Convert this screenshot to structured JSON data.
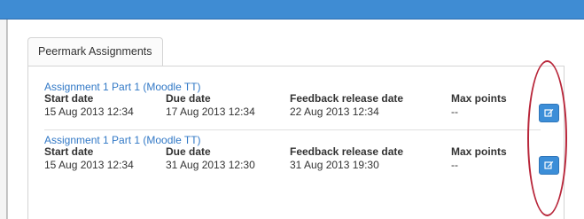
{
  "tab": {
    "label": "Peermark Assignments"
  },
  "headers": {
    "start": "Start date",
    "due": "Due date",
    "feedback": "Feedback release date",
    "max": "Max points"
  },
  "assignments": [
    {
      "title": "Assignment 1 Part 1 (Moodle TT)",
      "start": "15 Aug 2013 12:34",
      "due": "17 Aug 2013 12:34",
      "feedback": "22 Aug 2013 12:34",
      "max": "--"
    },
    {
      "title": "Assignment 1 Part 1 (Moodle TT)",
      "start": "15 Aug 2013 12:34",
      "due": "31 Aug 2013 12:30",
      "feedback": "31 Aug 2013 19:30",
      "max": "--"
    }
  ],
  "icons": {
    "edit": "edit-icon"
  },
  "colors": {
    "accent": "#3c8ed8",
    "link": "#3178c6",
    "annotation": "#b8263a"
  }
}
